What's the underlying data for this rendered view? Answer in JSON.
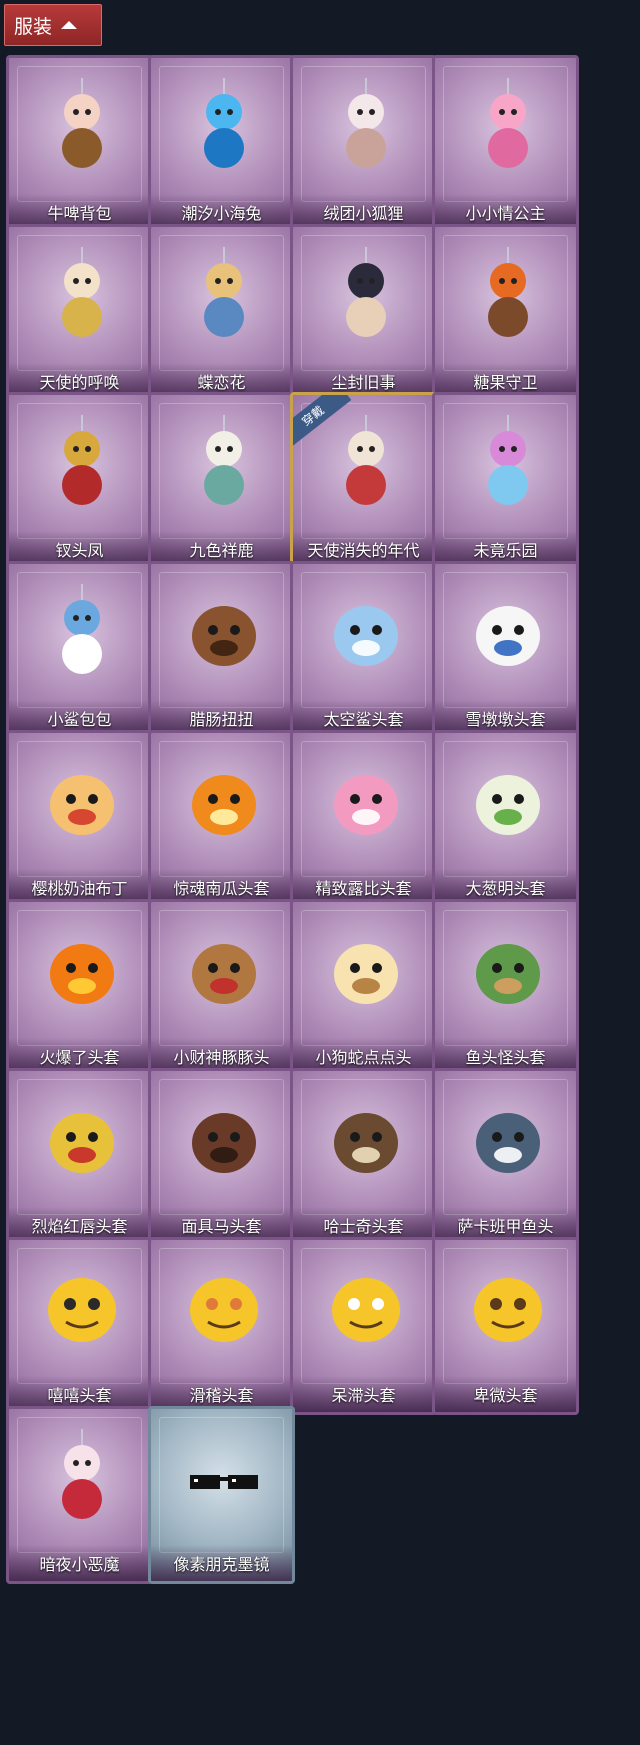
{
  "header": {
    "label": "服装"
  },
  "items": [
    {
      "name": "牛啤背包",
      "icon": "cow-beer-barrel-icon",
      "color": "#f4d3c4",
      "accent": "#8b5a2b"
    },
    {
      "name": "潮汐小海兔",
      "icon": "blue-sea-bunny-icon",
      "color": "#4bb6f0",
      "accent": "#1d77c2"
    },
    {
      "name": "绒团小狐狸",
      "icon": "white-fox-icon",
      "color": "#f3e7ea",
      "accent": "#c9a39a"
    },
    {
      "name": "小小情公主",
      "icon": "pink-princess-icon",
      "color": "#f7a6c7",
      "accent": "#e06aa0"
    },
    {
      "name": "天使的呼唤",
      "icon": "angel-doll-icon",
      "color": "#f4e1c9",
      "accent": "#d8b24a"
    },
    {
      "name": "蝶恋花",
      "icon": "bell-wreath-icon",
      "color": "#e8c27a",
      "accent": "#5a88c0"
    },
    {
      "name": "尘封旧事",
      "icon": "gentleman-doll-icon",
      "color": "#2a2a3a",
      "accent": "#e8d0b8"
    },
    {
      "name": "糖果守卫",
      "icon": "pumpkin-scarecrow-icon",
      "color": "#e76a23",
      "accent": "#7a4a2a"
    },
    {
      "name": "钗头凤",
      "icon": "phoenix-crown-icon",
      "color": "#d7a93c",
      "accent": "#b22a2a"
    },
    {
      "name": "九色祥鹿",
      "icon": "white-deer-icon",
      "color": "#f2efe6",
      "accent": "#6aa9a0"
    },
    {
      "name": "天使消失的年代",
      "icon": "veiled-doll-icon",
      "color": "#f0e4d6",
      "accent": "#c43a3a",
      "selected": true,
      "badge": "穿戴"
    },
    {
      "name": "未竟乐园",
      "icon": "pastel-clown-icon",
      "color": "#d88ad8",
      "accent": "#7fc8f0"
    },
    {
      "name": "小鲨包包",
      "icon": "shark-bag-icon",
      "color": "#6ba8e0",
      "accent": "#ffffff"
    },
    {
      "name": "腊肠扭扭",
      "icon": "dachshund-head-icon",
      "color": "#8a5330",
      "accent": "#3a2010"
    },
    {
      "name": "太空鲨头套",
      "icon": "space-shark-head-icon",
      "color": "#9ac8ee",
      "accent": "#ffffff"
    },
    {
      "name": "雪墩墩头套",
      "icon": "snowman-head-icon",
      "color": "#f6f6f6",
      "accent": "#2e66c0"
    },
    {
      "name": "樱桃奶油布丁",
      "icon": "pudding-head-icon",
      "color": "#f5c070",
      "accent": "#d23a2a"
    },
    {
      "name": "惊魂南瓜头套",
      "icon": "pumpkin-head-icon",
      "color": "#f08a1c",
      "accent": "#fff2a8"
    },
    {
      "name": "精致露比头套",
      "icon": "pink-beaver-head-icon",
      "color": "#f29ac0",
      "accent": "#ffffff"
    },
    {
      "name": "大葱明头套",
      "icon": "scallion-head-icon",
      "color": "#ecf2dc",
      "accent": "#5aa83a"
    },
    {
      "name": "火爆了头套",
      "icon": "fire-head-icon",
      "color": "#f27a12",
      "accent": "#ffd23a"
    },
    {
      "name": "小财神豚豚头",
      "icon": "capybara-head-icon",
      "color": "#b07840",
      "accent": "#c42a2a"
    },
    {
      "name": "小狗蛇点点头",
      "icon": "snake-head-icon",
      "color": "#f7e2b0",
      "accent": "#b07a3a"
    },
    {
      "name": "鱼头怪头套",
      "icon": "fish-head-icon",
      "color": "#5e9a4a",
      "accent": "#d8a060"
    },
    {
      "name": "烈焰红唇头套",
      "icon": "yellow-mouse-head-icon",
      "color": "#e8c13a",
      "accent": "#c42a2a"
    },
    {
      "name": "面具马头套",
      "icon": "horse-head-icon",
      "color": "#6a3a28",
      "accent": "#2a1a10"
    },
    {
      "name": "哈士奇头套",
      "icon": "husky-head-icon",
      "color": "#6a4a30",
      "accent": "#f0e0c0"
    },
    {
      "name": "萨卡班甲鱼头",
      "icon": "sakabambaspis-head-icon",
      "color": "#4a5f78",
      "accent": "#ffffff"
    },
    {
      "name": "嘻嘻头套",
      "icon": "grin-emoji-head-icon",
      "color": "#f5c52a",
      "accent": "#2a2a2a"
    },
    {
      "name": "滑稽头套",
      "icon": "smirk-emoji-head-icon",
      "color": "#f5c52a",
      "accent": "#e07a3a"
    },
    {
      "name": "呆滞头套",
      "icon": "dazed-emoji-head-icon",
      "color": "#f5c52a",
      "accent": "#ffffff"
    },
    {
      "name": "卑微头套",
      "icon": "humble-emoji-head-icon",
      "color": "#f5c52a",
      "accent": "#5a3a1a"
    },
    {
      "name": "暗夜小恶魔",
      "icon": "little-devil-icon",
      "color": "#f8e2ea",
      "accent": "#c42a3a"
    },
    {
      "name": "像素朋克墨镜",
      "icon": "pixel-sunglasses-icon",
      "color": "#111111",
      "accent": "#ffffff",
      "special": true
    }
  ]
}
